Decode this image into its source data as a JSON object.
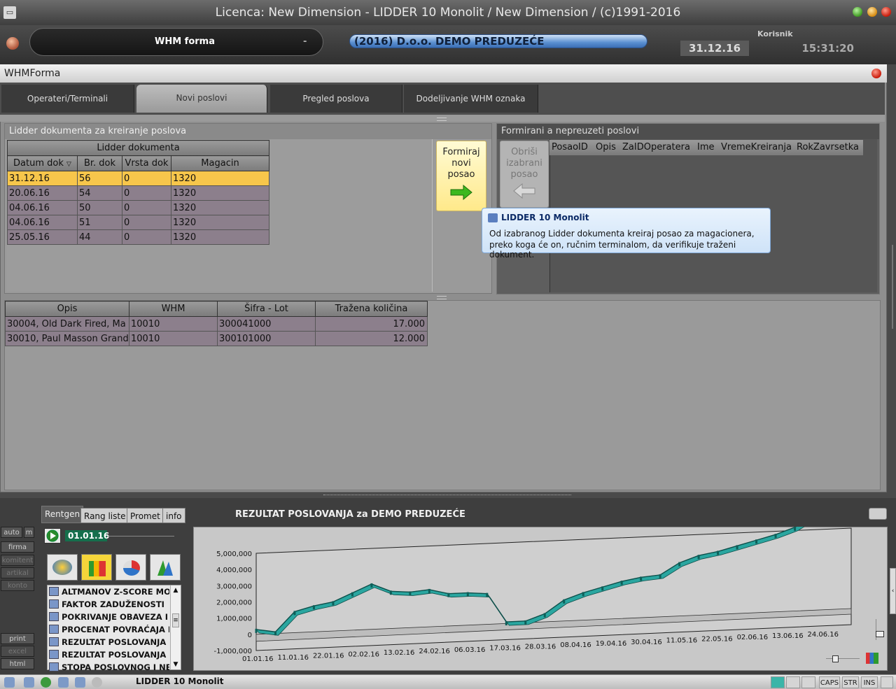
{
  "window": {
    "title": "Licenca: New Dimension - LIDDER 10 Monolit / New Dimension / (c)1991-2016"
  },
  "topbar": {
    "form_name": "WHM forma",
    "form_dash": "-",
    "company": "(2016) D.o.o. DEMO PREDUZEĆE",
    "korisnik_label": "Korisnik",
    "date": "31.12.16",
    "time": "15:31:20"
  },
  "form": {
    "title": "WHMForma",
    "tabs": [
      {
        "label": "Operateri/Terminali"
      },
      {
        "label": "Novi poslovi"
      },
      {
        "label": "Pregled poslova"
      },
      {
        "label": "Dodeljivanje WHM oznaka"
      }
    ],
    "left_panel": {
      "header": "Lidder dokumenta za kreiranje poslova",
      "group_header": "Lidder dokumenta",
      "columns": [
        "Datum dok",
        "Br. dok",
        "Vrsta dok",
        "Magacin"
      ],
      "rows": [
        {
          "datum": "31.12.16",
          "br": "56",
          "vrsta": "0",
          "magacin": "1320"
        },
        {
          "datum": "20.06.16",
          "br": "54",
          "vrsta": "0",
          "magacin": "1320"
        },
        {
          "datum": "04.06.16",
          "br": "50",
          "vrsta": "0",
          "magacin": "1320"
        },
        {
          "datum": "04.06.16",
          "br": "51",
          "vrsta": "0",
          "magacin": "1320"
        },
        {
          "datum": "25.05.16",
          "br": "44",
          "vrsta": "0",
          "magacin": "1320"
        }
      ]
    },
    "btn_formiraj": {
      "line1": "Formiraj",
      "line2": "novi",
      "line3": "posao"
    },
    "btn_obrisi": {
      "line1": "Obriši",
      "line2": "izabrani",
      "line3": "posao"
    },
    "right_panel": {
      "header": "Formirani a nepreuzeti poslovi",
      "columns": [
        "PosaoID",
        "Opis",
        "ZaIDOperatera",
        "Ime",
        "VremeKreiranja",
        "RokZavrsetka"
      ]
    },
    "detail": {
      "columns": [
        "Opis",
        "WHM",
        "Šifra - Lot",
        "Tražena količina"
      ],
      "rows": [
        {
          "opis": "30004, Old Dark Fired, Ma",
          "whm": "10010",
          "sifra": "300041000",
          "kolicina": "17.000"
        },
        {
          "opis": "30010, Paul Masson Grand",
          "whm": "10010",
          "sifra": "300101000",
          "kolicina": "12.000"
        }
      ]
    }
  },
  "tooltip": {
    "title": "LIDDER 10 Monolit",
    "line1": "Od izabranog Lidder dokumenta kreiraj posao za magacionera,",
    "line2": "preko koga će on, ručnim terminalom, da verifikuje traženi dokument."
  },
  "dashboard": {
    "tabs": [
      "Rentgen",
      "Rang liste",
      "Promet",
      "info"
    ],
    "title": "REZULTAT POSLOVANJA za DEMO PREDUZEĆE",
    "start_date": "01.01.16",
    "side_buttons": [
      "auto",
      "m",
      "firma",
      "komitent",
      "artikal",
      "konto",
      "print",
      "excel",
      "html"
    ],
    "list_items": [
      "ALTMANOV Z-SCORE MO",
      "FAKTOR ZADUŽENOSTI",
      "POKRIVANJE OBAVEZA I",
      "PROCENAT POVRAĆAJA I",
      "REZULTAT POSLOVANJA",
      "REZULTAT POSLOVANJA",
      "STOPA POSLOVNOG I NE"
    ]
  },
  "chart_data": {
    "type": "line",
    "title": "REZULTAT POSLOVANJA za DEMO PREDUZEĆE",
    "xlabel": "",
    "ylabel": "",
    "ylim": [
      -1000000,
      5000000
    ],
    "y_ticks": [
      "5,000,000",
      "4,000,000",
      "3,000,000",
      "2,000,000",
      "1,000,000",
      "0",
      "-1,000,000"
    ],
    "x_ticks": [
      "01.01.16",
      "11.01.16",
      "22.01.16",
      "02.02.16",
      "13.02.16",
      "24.02.16",
      "06.03.16",
      "17.03.16",
      "28.03.16",
      "08.04.16",
      "19.04.16",
      "30.04.16",
      "11.05.16",
      "22.05.16",
      "02.06.16",
      "13.06.16",
      "24.06.16"
    ],
    "series": [
      {
        "color": "#2aa6a0",
        "values": [
          300000,
          100000,
          1300000,
          1600000,
          1800000,
          2300000,
          2800000,
          2300000,
          2200000,
          2300000,
          2000000,
          2000000,
          1900000,
          100000,
          100000,
          500000,
          1300000,
          1700000,
          2000000,
          2300000,
          2500000,
          2600000,
          3300000,
          3700000,
          3900000,
          4200000,
          4500000,
          4800000,
          5200000,
          5900000,
          6000000
        ]
      }
    ]
  },
  "statusbar": {
    "app": "LIDDER 10 Monolit",
    "caps": "CAPS",
    "str": "STR",
    "ins": "INS"
  }
}
